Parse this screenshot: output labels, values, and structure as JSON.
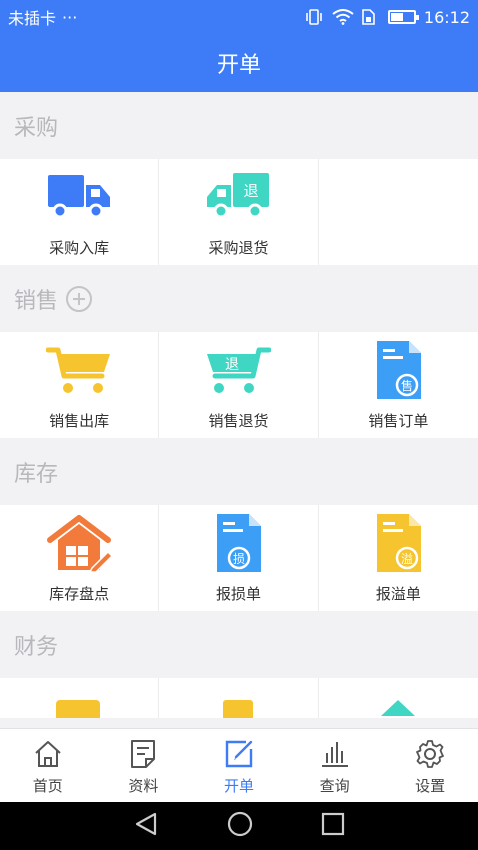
{
  "status_bar": {
    "carrier": "未插卡",
    "more": "···",
    "time": "16:12",
    "battery_level": 0.55
  },
  "title": "开单",
  "sections": [
    {
      "title": "采购",
      "items": [
        {
          "label": "采购入库",
          "icon": "truck-icon"
        },
        {
          "label": "采购退货",
          "icon": "return-truck-icon",
          "badge": "退"
        }
      ]
    },
    {
      "title": "销售",
      "items": [
        {
          "label": "销售出库",
          "icon": "cart-icon"
        },
        {
          "label": "销售退货",
          "icon": "return-cart-icon",
          "badge": "退"
        },
        {
          "label": "销售订单",
          "icon": "sales-order-doc-icon",
          "badge": "售"
        }
      ]
    },
    {
      "title": "库存",
      "items": [
        {
          "label": "库存盘点",
          "icon": "house-count-icon"
        },
        {
          "label": "报损单",
          "icon": "loss-doc-icon",
          "badge": "损"
        },
        {
          "label": "报溢单",
          "icon": "overflow-doc-icon",
          "badge": "溢"
        }
      ]
    },
    {
      "title": "财务",
      "items": []
    }
  ],
  "tabs": [
    {
      "label": "首页",
      "icon": "home-icon"
    },
    {
      "label": "资料",
      "icon": "document-icon"
    },
    {
      "label": "开单",
      "icon": "edit-icon",
      "active": true
    },
    {
      "label": "查询",
      "icon": "bar-chart-icon"
    },
    {
      "label": "设置",
      "icon": "gear-icon"
    }
  ],
  "colors": {
    "primary": "#3d7cf6",
    "teal": "#3fd6c4",
    "yellow": "#f6c42e",
    "orange": "#f27b3c"
  }
}
